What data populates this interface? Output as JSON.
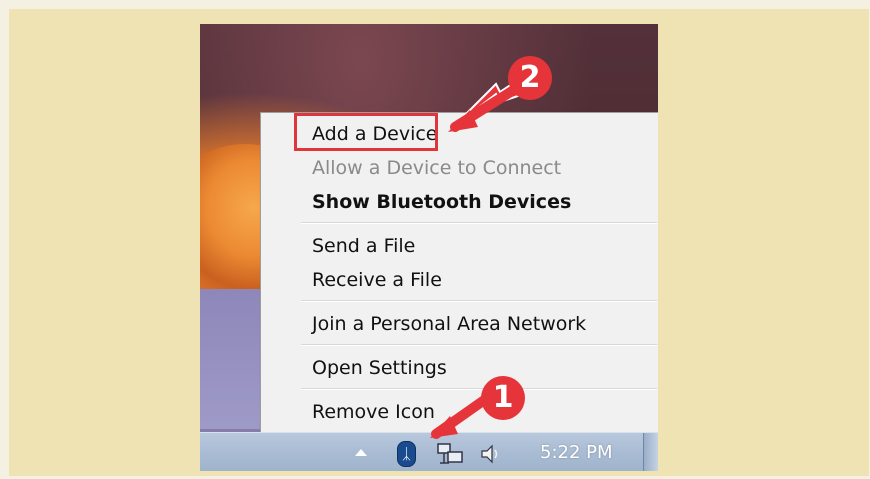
{
  "menu": {
    "items": [
      {
        "label": "Add a Device",
        "state": "normal"
      },
      {
        "label": "Allow a Device to Connect",
        "state": "disabled"
      },
      {
        "label": "Show Bluetooth Devices",
        "state": "bold"
      },
      {
        "label": "Send a File",
        "state": "normal"
      },
      {
        "label": "Receive a File",
        "state": "normal"
      },
      {
        "label": "Join a Personal Area Network",
        "state": "normal"
      },
      {
        "label": "Open Settings",
        "state": "normal"
      },
      {
        "label": "Remove Icon",
        "state": "normal"
      }
    ]
  },
  "taskbar": {
    "clock": "5:22 PM",
    "icons": [
      "show-hidden-icons-arrow",
      "bluetooth-icon",
      "network-icon",
      "volume-icon"
    ]
  },
  "callouts": {
    "step1": "1",
    "step2": "2",
    "color": "#e6343b"
  }
}
